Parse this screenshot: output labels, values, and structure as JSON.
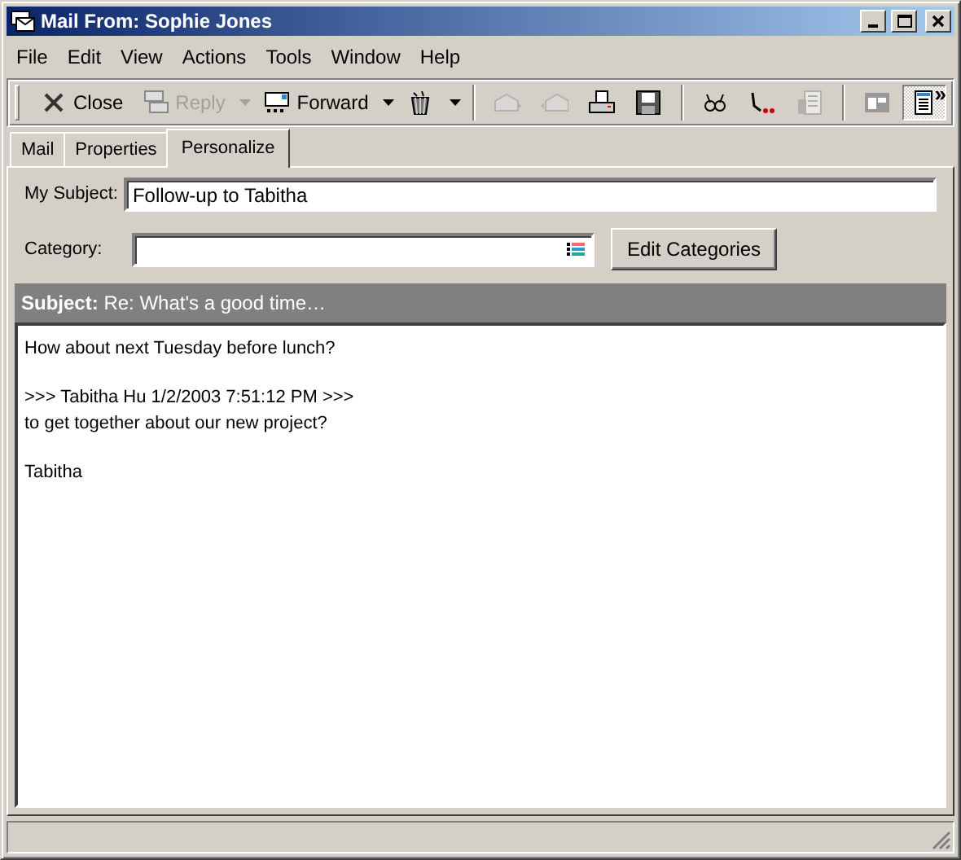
{
  "window": {
    "title": "Mail From: Sophie Jones"
  },
  "menu": [
    "File",
    "Edit",
    "View",
    "Actions",
    "Tools",
    "Window",
    "Help"
  ],
  "toolbar": [
    {
      "kind": "button",
      "label": "Close",
      "disabled": false
    },
    {
      "kind": "button",
      "label": "Reply",
      "disabled": true,
      "dropdown": true
    },
    {
      "kind": "button",
      "label": "Forward",
      "disabled": false,
      "dropdown": true
    },
    {
      "kind": "icon",
      "disabled": false,
      "dropdown": true
    },
    {
      "kind": "separator"
    },
    {
      "kind": "icon",
      "disabled": true
    },
    {
      "kind": "icon",
      "disabled": true
    },
    {
      "kind": "icon",
      "disabled": false
    },
    {
      "kind": "icon",
      "disabled": false
    },
    {
      "kind": "separator"
    },
    {
      "kind": "icon",
      "disabled": false
    },
    {
      "kind": "icon",
      "disabled": false
    },
    {
      "kind": "icon",
      "disabled": true
    },
    {
      "kind": "separator"
    },
    {
      "kind": "icon",
      "disabled": false
    },
    {
      "kind": "icon",
      "disabled": false,
      "pressed": true
    }
  ],
  "toolbar_overflow": "»",
  "tabs": [
    {
      "label": "Mail",
      "selected": false
    },
    {
      "label": "Properties",
      "selected": false
    },
    {
      "label": "Personalize",
      "selected": true
    }
  ],
  "personalize": {
    "my_subject_label": "My Subject:",
    "my_subject": "Follow-up to Tabitha",
    "category_label": "Category:",
    "edit_categories_button": "Edit Categories"
  },
  "message": {
    "subject_label": "Subject:",
    "subject": "Re: What's a good time…",
    "body": [
      [
        "How about next Tuesday before lunch?"
      ],
      [
        ">>> Tabitha Hu 1/2/2003 7:51:12 PM >>>",
        "to get together about our new project?"
      ],
      [
        "Tabitha"
      ]
    ]
  }
}
